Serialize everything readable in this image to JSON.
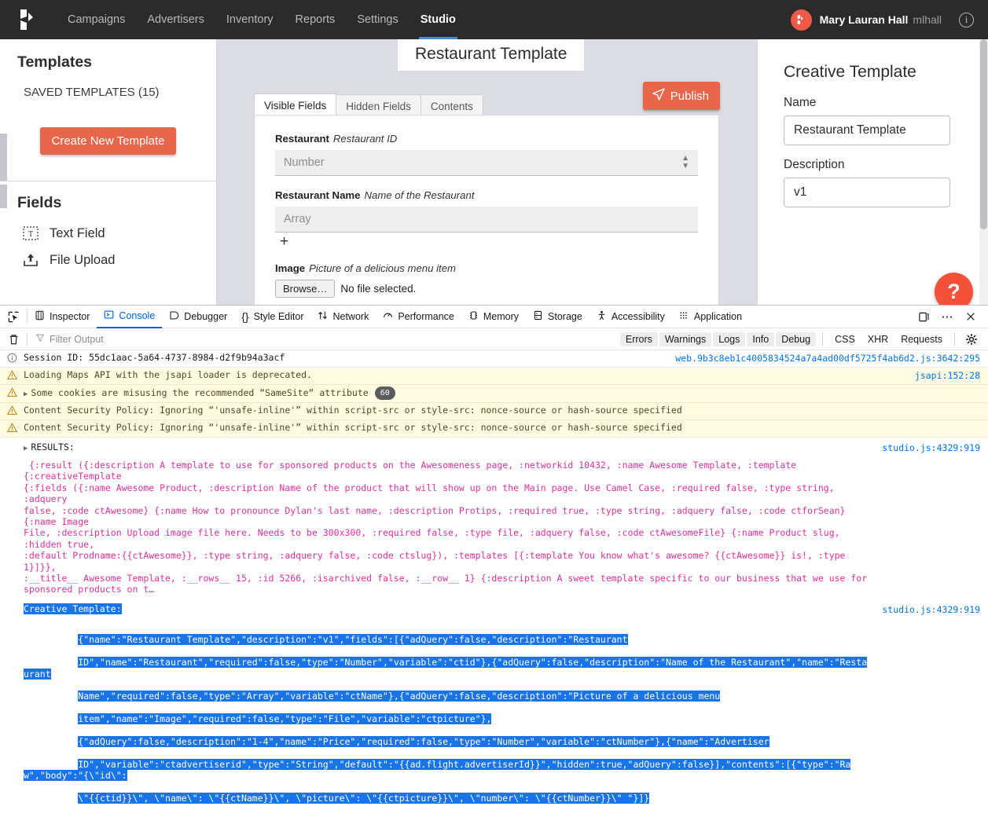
{
  "topnav": {
    "logo_name": "kevel-logo",
    "links": [
      {
        "label": "Campaigns",
        "active": false
      },
      {
        "label": "Advertisers",
        "active": false
      },
      {
        "label": "Inventory",
        "active": false
      },
      {
        "label": "Reports",
        "active": false
      },
      {
        "label": "Settings",
        "active": false
      },
      {
        "label": "Studio",
        "active": true
      }
    ],
    "user_name": "Mary Lauran Hall",
    "user_handle": "mlhall",
    "info_glyph": "i"
  },
  "sidebar": {
    "title": "Templates",
    "saved_templates": "SAVED TEMPLATES (15)",
    "create_button": "Create New Template",
    "fields_title": "Fields",
    "fields": [
      {
        "label": "Text Field",
        "icon": "text-field-icon"
      },
      {
        "label": "File Upload",
        "icon": "file-upload-icon"
      }
    ]
  },
  "center": {
    "template_title": "Restaurant Template",
    "publish_button": "Publish",
    "tabs": [
      {
        "label": "Visible Fields",
        "active": true
      },
      {
        "label": "Hidden Fields",
        "active": false
      },
      {
        "label": "Contents",
        "active": false
      }
    ],
    "fields": [
      {
        "name": "Restaurant",
        "description": "Restaurant ID",
        "placeholder": "Number",
        "kind": "number"
      },
      {
        "name": "Restaurant Name",
        "description": "Name of the Restaurant",
        "placeholder": "Array",
        "kind": "array",
        "add_glyph": "+"
      },
      {
        "name": "Image",
        "description": "Picture of a delicious menu item",
        "browse_label": "Browse…",
        "file_status": "No file selected.",
        "kind": "file"
      }
    ]
  },
  "rightpanel": {
    "title": "Creative Template",
    "name_label": "Name",
    "name_value": "Restaurant Template",
    "description_label": "Description",
    "description_value": "v1",
    "help_glyph": "?"
  },
  "devtools": {
    "tabs": [
      {
        "label": "Inspector",
        "icon": "inspector-icon",
        "active": false
      },
      {
        "label": "Console",
        "icon": "console-icon",
        "active": true
      },
      {
        "label": "Debugger",
        "icon": "debugger-icon",
        "active": false
      },
      {
        "label": "Style Editor",
        "icon": "style-editor-icon",
        "active": false
      },
      {
        "label": "Network",
        "icon": "network-icon",
        "active": false
      },
      {
        "label": "Performance",
        "icon": "performance-icon",
        "active": false
      },
      {
        "label": "Memory",
        "icon": "memory-icon",
        "active": false
      },
      {
        "label": "Storage",
        "icon": "storage-icon",
        "active": false
      },
      {
        "label": "Accessibility",
        "icon": "accessibility-icon",
        "active": false
      },
      {
        "label": "Application",
        "icon": "application-icon",
        "active": false
      }
    ],
    "filter_placeholder": "Filter Output",
    "filter_buttons": [
      "Errors",
      "Warnings",
      "Logs",
      "Info",
      "Debug"
    ],
    "filter_plain_buttons": [
      "CSS",
      "XHR",
      "Requests"
    ],
    "rows": [
      {
        "level": "info",
        "text": "Session ID: 55dc1aac-5a64-4737-8984-d2f9b94a3acf",
        "source": "web.9b3c8eb1c4005834524a7a4ad00df5725f4ab6d2.js:3642:295"
      },
      {
        "level": "warn",
        "text": "Loading Maps API with the jsapi loader is deprecated.",
        "source": "jsapi:152:28"
      },
      {
        "level": "warn",
        "expandable": true,
        "text": "Some cookies are misusing the recommended “SameSite“ attribute",
        "count": "60",
        "source": ""
      },
      {
        "level": "warn",
        "text": "Content Security Policy: Ignoring “'unsafe-inline'” within script-src or style-src: nonce-source or hash-source specified",
        "source": ""
      },
      {
        "level": "warn",
        "text": "Content Security Policy: Ignoring “'unsafe-inline'” within script-src or style-src: nonce-source or hash-source specified",
        "source": ""
      }
    ],
    "results": {
      "header": "RESULTS:",
      "source": "studio.js:4329:919",
      "body": " {:result ({:description A template to use for sponsored products on the Awesomeness page, :networkid 10432, :name Awesome Template, :template {:creativeTemplate\n{:fields ({:name Awesome Product, :description Name of the product that will show up on the Main page. Use Camel Case, :required false, :type string, :adquery\nfalse, :code ctAwesome} {:name How to pronounce Dylan's last name, :description Protips, :required true, :type string, :adquery false, :code ctforSean} {:name Image\nFile, :description Upload image file here. Needs to be 300x300, :required false, :type file, :adquery false, :code ctAwesomeFile} {:name Product slug, :hidden true,\n:default Prodname:{{ctAwesome}}, :type string, :adquery false, :code ctslug}), :templates [{:template You know what's awesome? {{ctAwesome}} is!, :type 1}]}},\n:__title__ Awesome Template, :__rows__ 15, :id 5266, :isarchived false, :__row__ 1} {:description A sweet template specific to our business that we use for\nsponsored products on t…"
    },
    "creative_template": {
      "label": "Creative Template:",
      "source": "studio.js:4329:919",
      "lines": [
        "{\"name\":\"Restaurant Template\",\"description\":\"v1\",\"fields\":[{\"adQuery\":false,\"description\":\"Restaurant",
        "ID\",\"name\":\"Restaurant\",\"required\":false,\"type\":\"Number\",\"variable\":\"ctid\"},{\"adQuery\":false,\"description\":\"Name of the Restaurant\",\"name\":\"Restaurant",
        "Name\",\"required\":false,\"type\":\"Array\",\"variable\":\"ctName\"},{\"adQuery\":false,\"description\":\"Picture of a delicious menu",
        "item\",\"name\":\"Image\",\"required\":false,\"type\":\"File\",\"variable\":\"ctpicture\"},",
        "{\"adQuery\":false,\"description\":\"1-4\",\"name\":\"Price\",\"required\":false,\"type\":\"Number\",\"variable\":\"ctNumber\"},{\"name\":\"Advertiser",
        "ID\",\"variable\":\"ctadvertiserid\",\"type\":\"String\",\"default\":\"{{ad.flight.advertiserId}}\",\"hidden\":true,\"adQuery\":false}],\"contents\":[{\"type\":\"Raw\",\"body\":\"{\\\"id\\\":",
        "\\\"{{ctid}}\\\", \\\"name\\\": \\\"{{ctName}}\\\", \\\"picture\\\": \\\"{{ctpicture}}\\\", \\\"number\\\": \\\"{{ctNumber}}\\\" \"}]}"
      ]
    }
  }
}
